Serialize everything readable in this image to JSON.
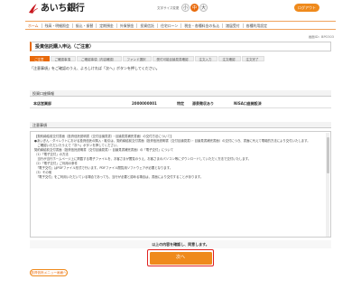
{
  "header": {
    "bank_name": "あいち銀行",
    "font_size_label": "文字サイズ変更",
    "font_sizes": [
      "小",
      "中",
      "大"
    ],
    "logout_label": "ログアウト"
  },
  "nav": {
    "items": [
      "ホーム",
      "残高・明細照会",
      "振込・振替",
      "定期預金",
      "外貨預金",
      "投資信託",
      "住宅ローン",
      "税金・各種料金の払込",
      "諸届受付",
      "各種利用設定"
    ]
  },
  "screen_id": "画面ID：BPO303",
  "page_title": "投資信託購入申込（ご注意）",
  "steps": [
    "ご注意",
    "ご確認事項",
    "ご確認事項（内容確認）",
    "ファンド選択",
    "受付可能目論見書確認",
    "注文入力",
    "注文確認",
    "注文完了"
  ],
  "instruction": "「注意事項」をご確認のうえ、よろしければ「次へ」ボタンを押してください。",
  "account_section": {
    "heading": "投資口座情報",
    "branch": "本店営業部",
    "account_number": "2000000001",
    "type": "特定",
    "withholding": "源泉徴収あり",
    "nisa": "NISA口座開設済"
  },
  "notes_section": {
    "heading": "注意事項",
    "lines": [
      "【契約締結前交付書面（投資信託説明書（交付目論見書）・目論見書補完書面）の交付方法について】",
      "●あいぎん・ダイレクトにおける投資信託の購入・取引は、契約締結前交付書面（投資信託説明書（交付目論見書）・目論見書補完書面）の交付につき、書面に代えて電磁的方法により交付いたします。",
      "　ご確認いただいたうえで「次へ」ボタンを押してください。",
      "契約締結前交付書面（投資信託説明書（交付目論見書）・目論見書補完書面）の「電子交付」について",
      "（1）「電子交付」の方法",
      "　当行が当行ホームページ上に掲載する電子ファイルを、お客さまが閲覧のうえ、お客さまのパソコン等にダウンロードしていただく方法で交付いたします。",
      "（2）「電子交付」ご利用の条件",
      "　「電子交付」はPDFファイル形式で行います。PDFファイル閲覧用ソフトウェアが必要となります。",
      "（3）その他",
      "　「電子交付」をご利用いただいている場合であっても、当行が必要と認める場合は、書面により交付することがあります。"
    ]
  },
  "confirm_message": "以上の内容を確認し、同意します。",
  "next_label": "次へ",
  "back_to_menu_label": "投資信託メニュー画面へ",
  "colors": {
    "accent": "#e86a0c",
    "button_orange": "#ef8a1c",
    "highlight_border": "#e02020"
  }
}
